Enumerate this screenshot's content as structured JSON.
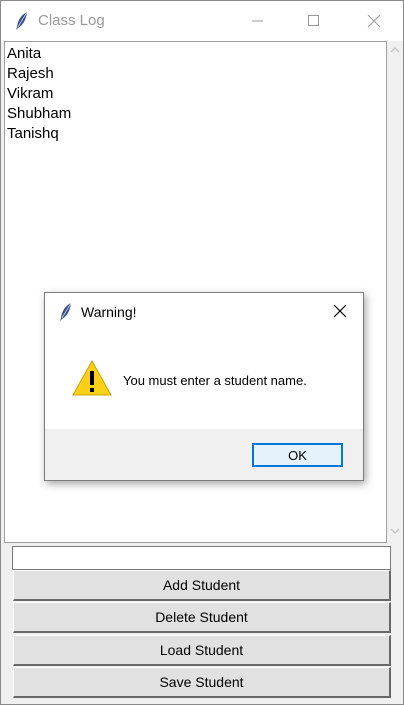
{
  "window": {
    "title": "Class Log",
    "icon": "feather-icon"
  },
  "students": [
    "Anita",
    "Rajesh",
    "Vikram",
    "Shubham",
    "Tanishq"
  ],
  "entry": {
    "value": ""
  },
  "buttons": {
    "add": "Add Student",
    "delete": "Delete Student",
    "load": "Load Student",
    "save": "Save Student"
  },
  "dialog": {
    "title": "Warning!",
    "message": "You must enter a student name.",
    "ok_label": "OK",
    "icon": "warning-icon"
  },
  "colors": {
    "accent": "#0078d7",
    "warning_yellow": "#fcd116"
  }
}
